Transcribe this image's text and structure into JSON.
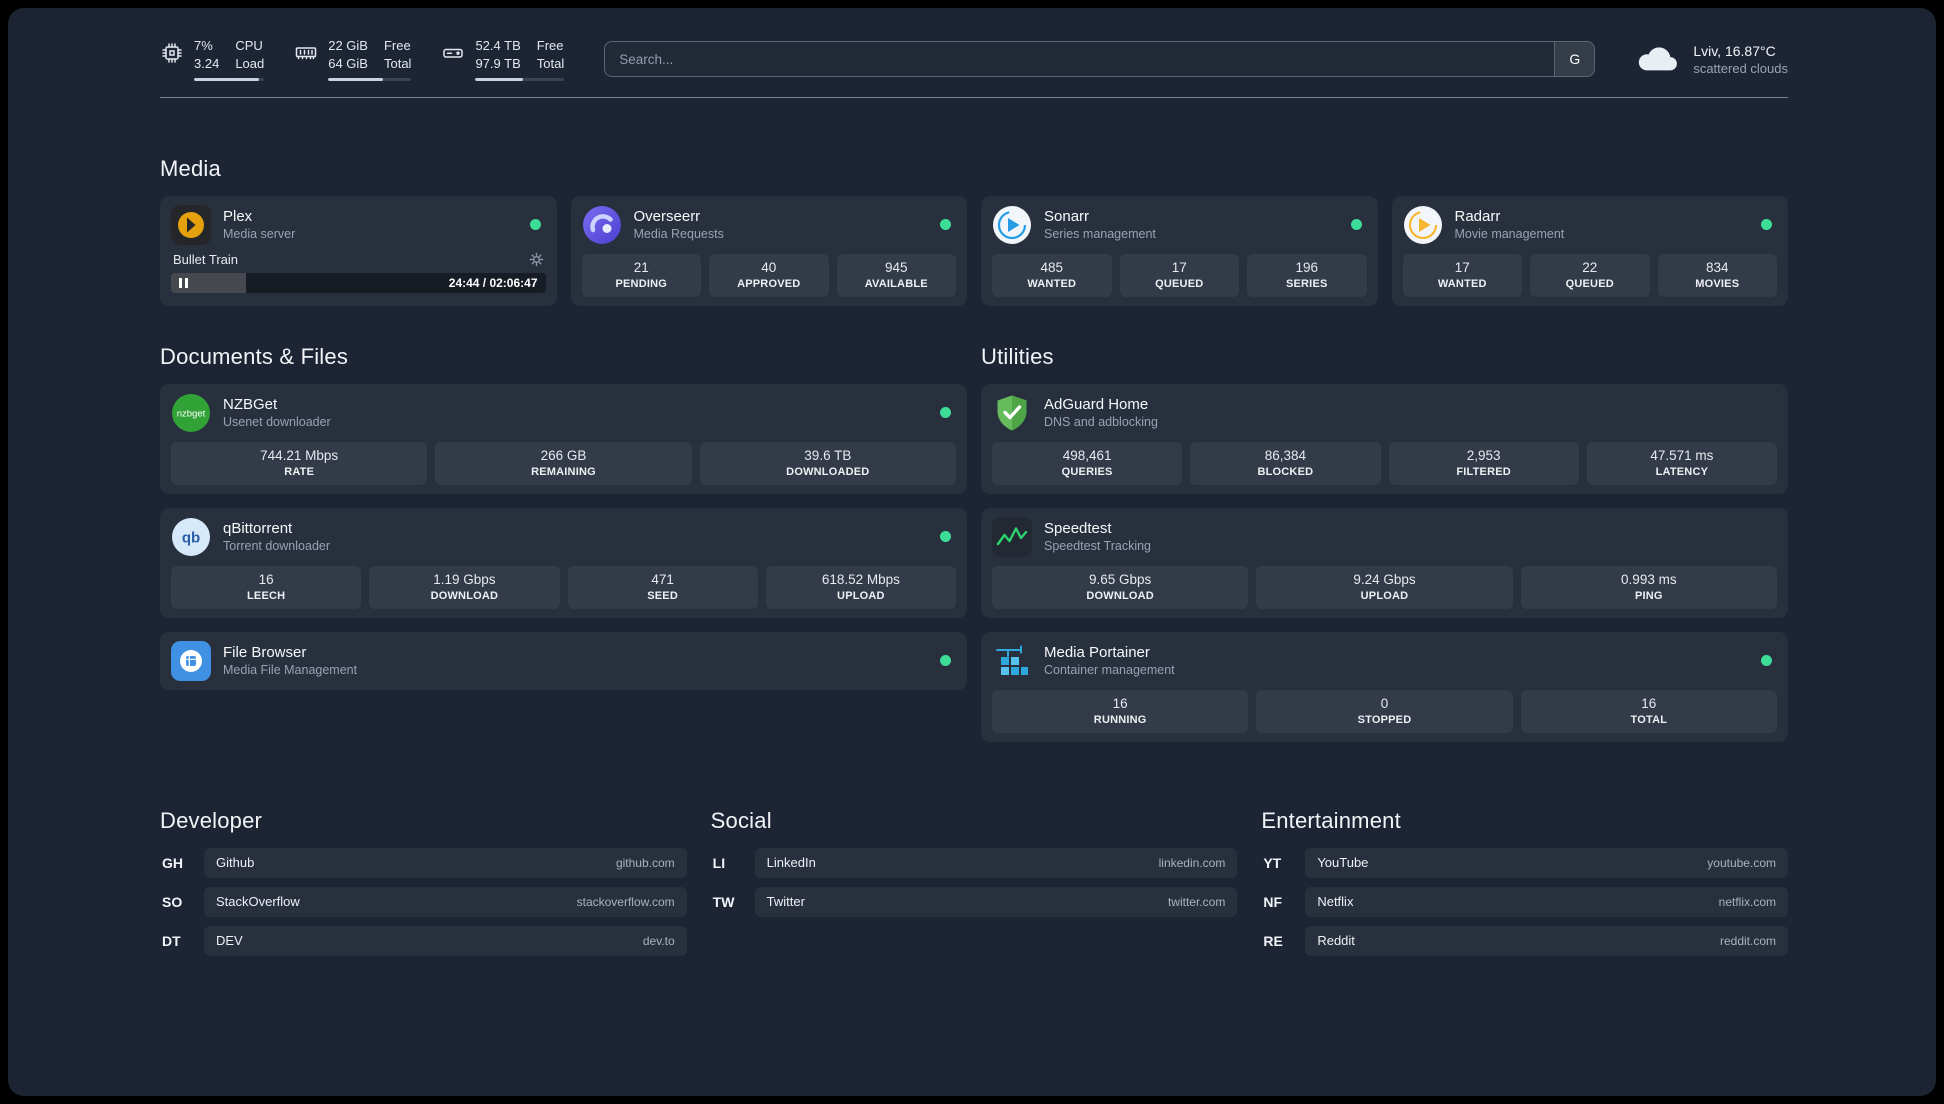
{
  "colors": {
    "status_online": "#3ddc97",
    "background": "#1d2534",
    "accent_blue": "#2ea7dd"
  },
  "topbar": {
    "cpu": {
      "usage": "7%",
      "load": "3.24",
      "labels": [
        "CPU",
        "Load"
      ]
    },
    "memory": {
      "free": "22 GiB",
      "total": "64 GiB",
      "labels": [
        "Free",
        "Total"
      ]
    },
    "disk": {
      "free": "52.4 TB",
      "total": "97.9 TB",
      "labels": [
        "Free",
        "Total"
      ]
    },
    "search": {
      "placeholder": "Search...",
      "provider": "G"
    },
    "weather": {
      "location": "Lviv, 16.87°C",
      "condition": "scattered clouds"
    }
  },
  "media": {
    "title": "Media",
    "plex": {
      "name": "Plex",
      "subtitle": "Media server",
      "now_playing": "Bullet Train",
      "progress_time": "24:44 / 02:06:47"
    },
    "overseerr": {
      "name": "Overseerr",
      "subtitle": "Media Requests",
      "stats": [
        {
          "value": "21",
          "label": "PENDING"
        },
        {
          "value": "40",
          "label": "APPROVED"
        },
        {
          "value": "945",
          "label": "AVAILABLE"
        }
      ]
    },
    "sonarr": {
      "name": "Sonarr",
      "subtitle": "Series management",
      "stats": [
        {
          "value": "485",
          "label": "WANTED"
        },
        {
          "value": "17",
          "label": "QUEUED"
        },
        {
          "value": "196",
          "label": "SERIES"
        }
      ]
    },
    "radarr": {
      "name": "Radarr",
      "subtitle": "Movie management",
      "stats": [
        {
          "value": "17",
          "label": "WANTED"
        },
        {
          "value": "22",
          "label": "QUEUED"
        },
        {
          "value": "834",
          "label": "MOVIES"
        }
      ]
    }
  },
  "documents": {
    "title": "Documents & Files",
    "nzbget": {
      "name": "NZBGet",
      "subtitle": "Usenet downloader",
      "stats": [
        {
          "value": "744.21 Mbps",
          "label": "RATE"
        },
        {
          "value": "266 GB",
          "label": "REMAINING"
        },
        {
          "value": "39.6 TB",
          "label": "DOWNLOADED"
        }
      ]
    },
    "qbittorrent": {
      "name": "qBittorrent",
      "subtitle": "Torrent downloader",
      "stats": [
        {
          "value": "16",
          "label": "LEECH"
        },
        {
          "value": "1.19 Gbps",
          "label": "DOWNLOAD"
        },
        {
          "value": "471",
          "label": "SEED"
        },
        {
          "value": "618.52 Mbps",
          "label": "UPLOAD"
        }
      ]
    },
    "filebrowser": {
      "name": "File Browser",
      "subtitle": "Media File Management"
    }
  },
  "utilities": {
    "title": "Utilities",
    "adguard": {
      "name": "AdGuard Home",
      "subtitle": "DNS and adblocking",
      "stats": [
        {
          "value": "498,461",
          "label": "QUERIES"
        },
        {
          "value": "86,384",
          "label": "BLOCKED"
        },
        {
          "value": "2,953",
          "label": "FILTERED"
        },
        {
          "value": "47.571 ms",
          "label": "LATENCY"
        }
      ]
    },
    "speedtest": {
      "name": "Speedtest",
      "subtitle": "Speedtest Tracking",
      "stats": [
        {
          "value": "9.65 Gbps",
          "label": "DOWNLOAD"
        },
        {
          "value": "9.24 Gbps",
          "label": "UPLOAD"
        },
        {
          "value": "0.993 ms",
          "label": "PING"
        }
      ]
    },
    "portainer": {
      "name": "Media Portainer",
      "subtitle": "Container management",
      "stats": [
        {
          "value": "16",
          "label": "RUNNING"
        },
        {
          "value": "0",
          "label": "STOPPED"
        },
        {
          "value": "16",
          "label": "TOTAL"
        }
      ]
    }
  },
  "bookmarks": [
    {
      "title": "Developer",
      "items": [
        {
          "abbr": "GH",
          "name": "Github",
          "url": "github.com"
        },
        {
          "abbr": "SO",
          "name": "StackOverflow",
          "url": "stackoverflow.com"
        },
        {
          "abbr": "DT",
          "name": "DEV",
          "url": "dev.to"
        }
      ]
    },
    {
      "title": "Social",
      "items": [
        {
          "abbr": "LI",
          "name": "LinkedIn",
          "url": "linkedin.com"
        },
        {
          "abbr": "TW",
          "name": "Twitter",
          "url": "twitter.com"
        }
      ]
    },
    {
      "title": "Entertainment",
      "items": [
        {
          "abbr": "YT",
          "name": "YouTube",
          "url": "youtube.com"
        },
        {
          "abbr": "NF",
          "name": "Netflix",
          "url": "netflix.com"
        },
        {
          "abbr": "RE",
          "name": "Reddit",
          "url": "reddit.com"
        }
      ]
    }
  ]
}
